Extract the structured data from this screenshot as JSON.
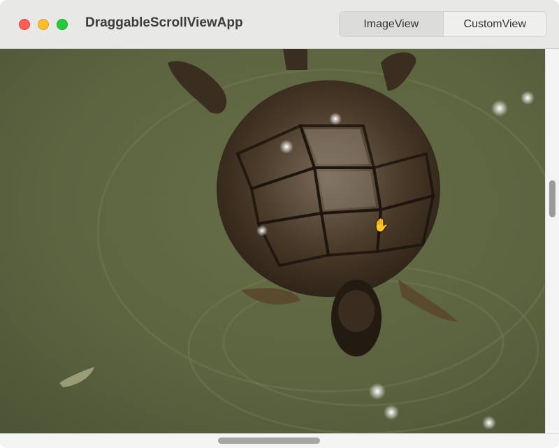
{
  "window": {
    "title": "DraggableScrollViewApp"
  },
  "toolbar": {
    "segments": [
      {
        "label": "ImageView",
        "selected": true
      },
      {
        "label": "CustomView",
        "selected": false
      }
    ]
  },
  "content": {
    "image_subject": "turtle swimming in green water",
    "cursor": "open-hand-icon"
  },
  "colors": {
    "close": "#ff5f57",
    "minimize": "#febc2e",
    "maximize": "#28c840",
    "water": "#5c6440"
  }
}
